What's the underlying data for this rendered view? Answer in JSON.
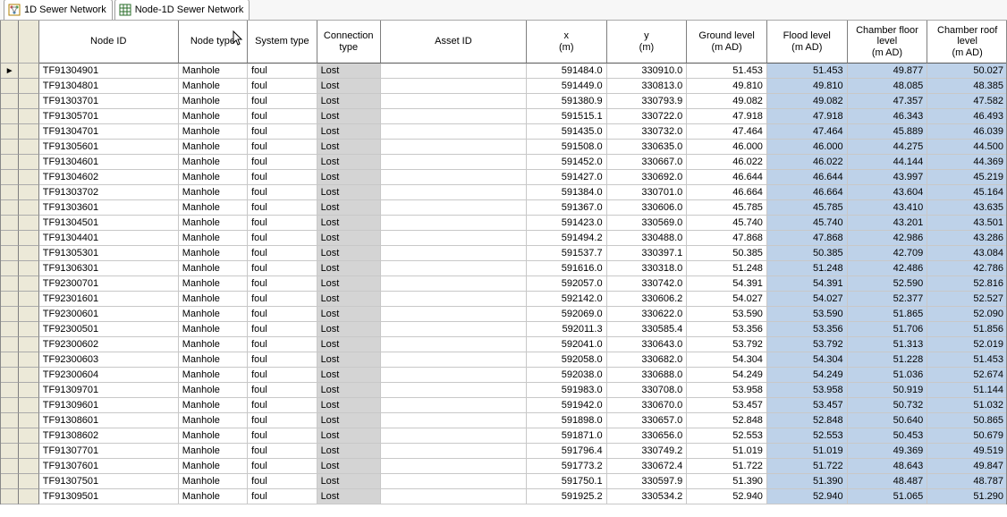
{
  "tabs": [
    {
      "label": "1D Sewer Network"
    },
    {
      "label": "Node-1D Sewer Network"
    }
  ],
  "columns": [
    "",
    "",
    "Node ID",
    "Node type",
    "System type",
    "Connection\ntype",
    "Asset ID",
    "x\n(m)",
    "y\n(m)",
    "Ground level\n(m AD)",
    "Flood level\n(m AD)",
    "Chamber floor\nlevel\n(m AD)",
    "Chamber roof\nlevel\n(m AD)"
  ],
  "rows": [
    {
      "mark": "►",
      "node_id": "TF91304901",
      "node_type": "Manhole",
      "system_type": "foul",
      "connection_type": "Lost",
      "asset_id": "",
      "x": "591484.0",
      "y": "330910.0",
      "ground": "51.453",
      "flood": "51.453",
      "chfloor": "49.877",
      "chroof": "50.027"
    },
    {
      "mark": "",
      "node_id": "TF91304801",
      "node_type": "Manhole",
      "system_type": "foul",
      "connection_type": "Lost",
      "asset_id": "",
      "x": "591449.0",
      "y": "330813.0",
      "ground": "49.810",
      "flood": "49.810",
      "chfloor": "48.085",
      "chroof": "48.385"
    },
    {
      "mark": "",
      "node_id": "TF91303701",
      "node_type": "Manhole",
      "system_type": "foul",
      "connection_type": "Lost",
      "asset_id": "",
      "x": "591380.9",
      "y": "330793.9",
      "ground": "49.082",
      "flood": "49.082",
      "chfloor": "47.357",
      "chroof": "47.582"
    },
    {
      "mark": "",
      "node_id": "TF91305701",
      "node_type": "Manhole",
      "system_type": "foul",
      "connection_type": "Lost",
      "asset_id": "",
      "x": "591515.1",
      "y": "330722.0",
      "ground": "47.918",
      "flood": "47.918",
      "chfloor": "46.343",
      "chroof": "46.493"
    },
    {
      "mark": "",
      "node_id": "TF91304701",
      "node_type": "Manhole",
      "system_type": "foul",
      "connection_type": "Lost",
      "asset_id": "",
      "x": "591435.0",
      "y": "330732.0",
      "ground": "47.464",
      "flood": "47.464",
      "chfloor": "45.889",
      "chroof": "46.039"
    },
    {
      "mark": "",
      "node_id": "TF91305601",
      "node_type": "Manhole",
      "system_type": "foul",
      "connection_type": "Lost",
      "asset_id": "",
      "x": "591508.0",
      "y": "330635.0",
      "ground": "46.000",
      "flood": "46.000",
      "chfloor": "44.275",
      "chroof": "44.500"
    },
    {
      "mark": "",
      "node_id": "TF91304601",
      "node_type": "Manhole",
      "system_type": "foul",
      "connection_type": "Lost",
      "asset_id": "",
      "x": "591452.0",
      "y": "330667.0",
      "ground": "46.022",
      "flood": "46.022",
      "chfloor": "44.144",
      "chroof": "44.369"
    },
    {
      "mark": "",
      "node_id": "TF91304602",
      "node_type": "Manhole",
      "system_type": "foul",
      "connection_type": "Lost",
      "asset_id": "",
      "x": "591427.0",
      "y": "330692.0",
      "ground": "46.644",
      "flood": "46.644",
      "chfloor": "43.997",
      "chroof": "45.219"
    },
    {
      "mark": "",
      "node_id": "TF91303702",
      "node_type": "Manhole",
      "system_type": "foul",
      "connection_type": "Lost",
      "asset_id": "",
      "x": "591384.0",
      "y": "330701.0",
      "ground": "46.664",
      "flood": "46.664",
      "chfloor": "43.604",
      "chroof": "45.164"
    },
    {
      "mark": "",
      "node_id": "TF91303601",
      "node_type": "Manhole",
      "system_type": "foul",
      "connection_type": "Lost",
      "asset_id": "",
      "x": "591367.0",
      "y": "330606.0",
      "ground": "45.785",
      "flood": "45.785",
      "chfloor": "43.410",
      "chroof": "43.635"
    },
    {
      "mark": "",
      "node_id": "TF91304501",
      "node_type": "Manhole",
      "system_type": "foul",
      "connection_type": "Lost",
      "asset_id": "",
      "x": "591423.0",
      "y": "330569.0",
      "ground": "45.740",
      "flood": "45.740",
      "chfloor": "43.201",
      "chroof": "43.501"
    },
    {
      "mark": "",
      "node_id": "TF91304401",
      "node_type": "Manhole",
      "system_type": "foul",
      "connection_type": "Lost",
      "asset_id": "",
      "x": "591494.2",
      "y": "330488.0",
      "ground": "47.868",
      "flood": "47.868",
      "chfloor": "42.986",
      "chroof": "43.286"
    },
    {
      "mark": "",
      "node_id": "TF91305301",
      "node_type": "Manhole",
      "system_type": "foul",
      "connection_type": "Lost",
      "asset_id": "",
      "x": "591537.7",
      "y": "330397.1",
      "ground": "50.385",
      "flood": "50.385",
      "chfloor": "42.709",
      "chroof": "43.084"
    },
    {
      "mark": "",
      "node_id": "TF91306301",
      "node_type": "Manhole",
      "system_type": "foul",
      "connection_type": "Lost",
      "asset_id": "",
      "x": "591616.0",
      "y": "330318.0",
      "ground": "51.248",
      "flood": "51.248",
      "chfloor": "42.486",
      "chroof": "42.786"
    },
    {
      "mark": "",
      "node_id": "TF92300701",
      "node_type": "Manhole",
      "system_type": "foul",
      "connection_type": "Lost",
      "asset_id": "",
      "x": "592057.0",
      "y": "330742.0",
      "ground": "54.391",
      "flood": "54.391",
      "chfloor": "52.590",
      "chroof": "52.816"
    },
    {
      "mark": "",
      "node_id": "TF92301601",
      "node_type": "Manhole",
      "system_type": "foul",
      "connection_type": "Lost",
      "asset_id": "",
      "x": "592142.0",
      "y": "330606.2",
      "ground": "54.027",
      "flood": "54.027",
      "chfloor": "52.377",
      "chroof": "52.527"
    },
    {
      "mark": "",
      "node_id": "TF92300601",
      "node_type": "Manhole",
      "system_type": "foul",
      "connection_type": "Lost",
      "asset_id": "",
      "x": "592069.0",
      "y": "330622.0",
      "ground": "53.590",
      "flood": "53.590",
      "chfloor": "51.865",
      "chroof": "52.090"
    },
    {
      "mark": "",
      "node_id": "TF92300501",
      "node_type": "Manhole",
      "system_type": "foul",
      "connection_type": "Lost",
      "asset_id": "",
      "x": "592011.3",
      "y": "330585.4",
      "ground": "53.356",
      "flood": "53.356",
      "chfloor": "51.706",
      "chroof": "51.856"
    },
    {
      "mark": "",
      "node_id": "TF92300602",
      "node_type": "Manhole",
      "system_type": "foul",
      "connection_type": "Lost",
      "asset_id": "",
      "x": "592041.0",
      "y": "330643.0",
      "ground": "53.792",
      "flood": "53.792",
      "chfloor": "51.313",
      "chroof": "52.019"
    },
    {
      "mark": "",
      "node_id": "TF92300603",
      "node_type": "Manhole",
      "system_type": "foul",
      "connection_type": "Lost",
      "asset_id": "",
      "x": "592058.0",
      "y": "330682.0",
      "ground": "54.304",
      "flood": "54.304",
      "chfloor": "51.228",
      "chroof": "51.453"
    },
    {
      "mark": "",
      "node_id": "TF92300604",
      "node_type": "Manhole",
      "system_type": "foul",
      "connection_type": "Lost",
      "asset_id": "",
      "x": "592038.0",
      "y": "330688.0",
      "ground": "54.249",
      "flood": "54.249",
      "chfloor": "51.036",
      "chroof": "52.674"
    },
    {
      "mark": "",
      "node_id": "TF91309701",
      "node_type": "Manhole",
      "system_type": "foul",
      "connection_type": "Lost",
      "asset_id": "",
      "x": "591983.0",
      "y": "330708.0",
      "ground": "53.958",
      "flood": "53.958",
      "chfloor": "50.919",
      "chroof": "51.144"
    },
    {
      "mark": "",
      "node_id": "TF91309601",
      "node_type": "Manhole",
      "system_type": "foul",
      "connection_type": "Lost",
      "asset_id": "",
      "x": "591942.0",
      "y": "330670.0",
      "ground": "53.457",
      "flood": "53.457",
      "chfloor": "50.732",
      "chroof": "51.032"
    },
    {
      "mark": "",
      "node_id": "TF91308601",
      "node_type": "Manhole",
      "system_type": "foul",
      "connection_type": "Lost",
      "asset_id": "",
      "x": "591898.0",
      "y": "330657.0",
      "ground": "52.848",
      "flood": "52.848",
      "chfloor": "50.640",
      "chroof": "50.865"
    },
    {
      "mark": "",
      "node_id": "TF91308602",
      "node_type": "Manhole",
      "system_type": "foul",
      "connection_type": "Lost",
      "asset_id": "",
      "x": "591871.0",
      "y": "330656.0",
      "ground": "52.553",
      "flood": "52.553",
      "chfloor": "50.453",
      "chroof": "50.679"
    },
    {
      "mark": "",
      "node_id": "TF91307701",
      "node_type": "Manhole",
      "system_type": "foul",
      "connection_type": "Lost",
      "asset_id": "",
      "x": "591796.4",
      "y": "330749.2",
      "ground": "51.019",
      "flood": "51.019",
      "chfloor": "49.369",
      "chroof": "49.519"
    },
    {
      "mark": "",
      "node_id": "TF91307601",
      "node_type": "Manhole",
      "system_type": "foul",
      "connection_type": "Lost",
      "asset_id": "",
      "x": "591773.2",
      "y": "330672.4",
      "ground": "51.722",
      "flood": "51.722",
      "chfloor": "48.643",
      "chroof": "49.847"
    },
    {
      "mark": "",
      "node_id": "TF91307501",
      "node_type": "Manhole",
      "system_type": "foul",
      "connection_type": "Lost",
      "asset_id": "",
      "x": "591750.1",
      "y": "330597.9",
      "ground": "51.390",
      "flood": "51.390",
      "chfloor": "48.487",
      "chroof": "48.787"
    },
    {
      "mark": "",
      "node_id": "TF91309501",
      "node_type": "Manhole",
      "system_type": "foul",
      "connection_type": "Lost",
      "asset_id": "",
      "x": "591925.2",
      "y": "330534.2",
      "ground": "52.940",
      "flood": "52.940",
      "chfloor": "51.065",
      "chroof": "51.290"
    }
  ]
}
